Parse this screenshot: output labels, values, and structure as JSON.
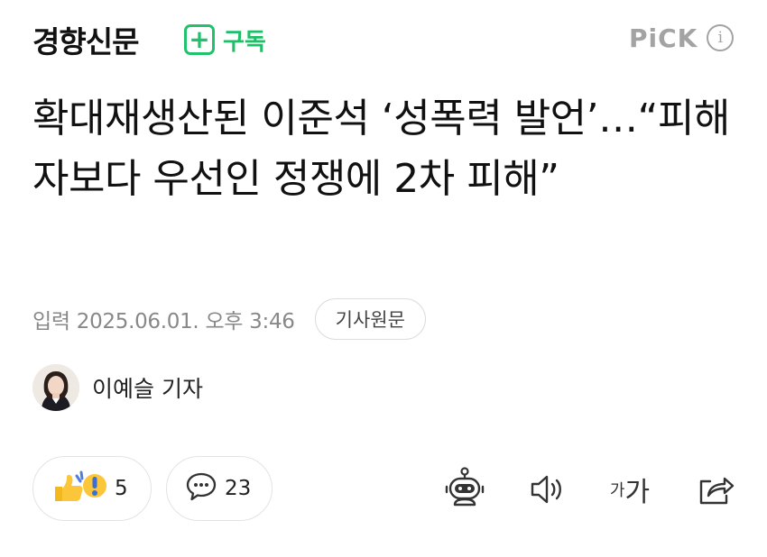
{
  "header": {
    "press_name": "경향신문",
    "subscribe_label": "구독",
    "pick_label": "PiCK",
    "info_symbol": "i"
  },
  "article": {
    "headline": "확대재생산된 이준석 ‘성폭력 발언’…“피해자보다 우선인 정쟁에 2차 피해”",
    "published": "입력 2025.06.01. 오후 3:46",
    "original_link_label": "기사원문",
    "reporter": "이예슬 기자"
  },
  "actions": {
    "reaction_count": "5",
    "comment_count": "23",
    "font_small": "가",
    "font_big": "가"
  },
  "colors": {
    "brand_green": "#20c26b",
    "muted_gray": "#a3a3a3"
  },
  "icons": [
    "plus-icon",
    "info-icon",
    "reaction-icon",
    "comment-icon",
    "robot-summary-icon",
    "speaker-icon",
    "font-size-icon",
    "share-icon"
  ]
}
